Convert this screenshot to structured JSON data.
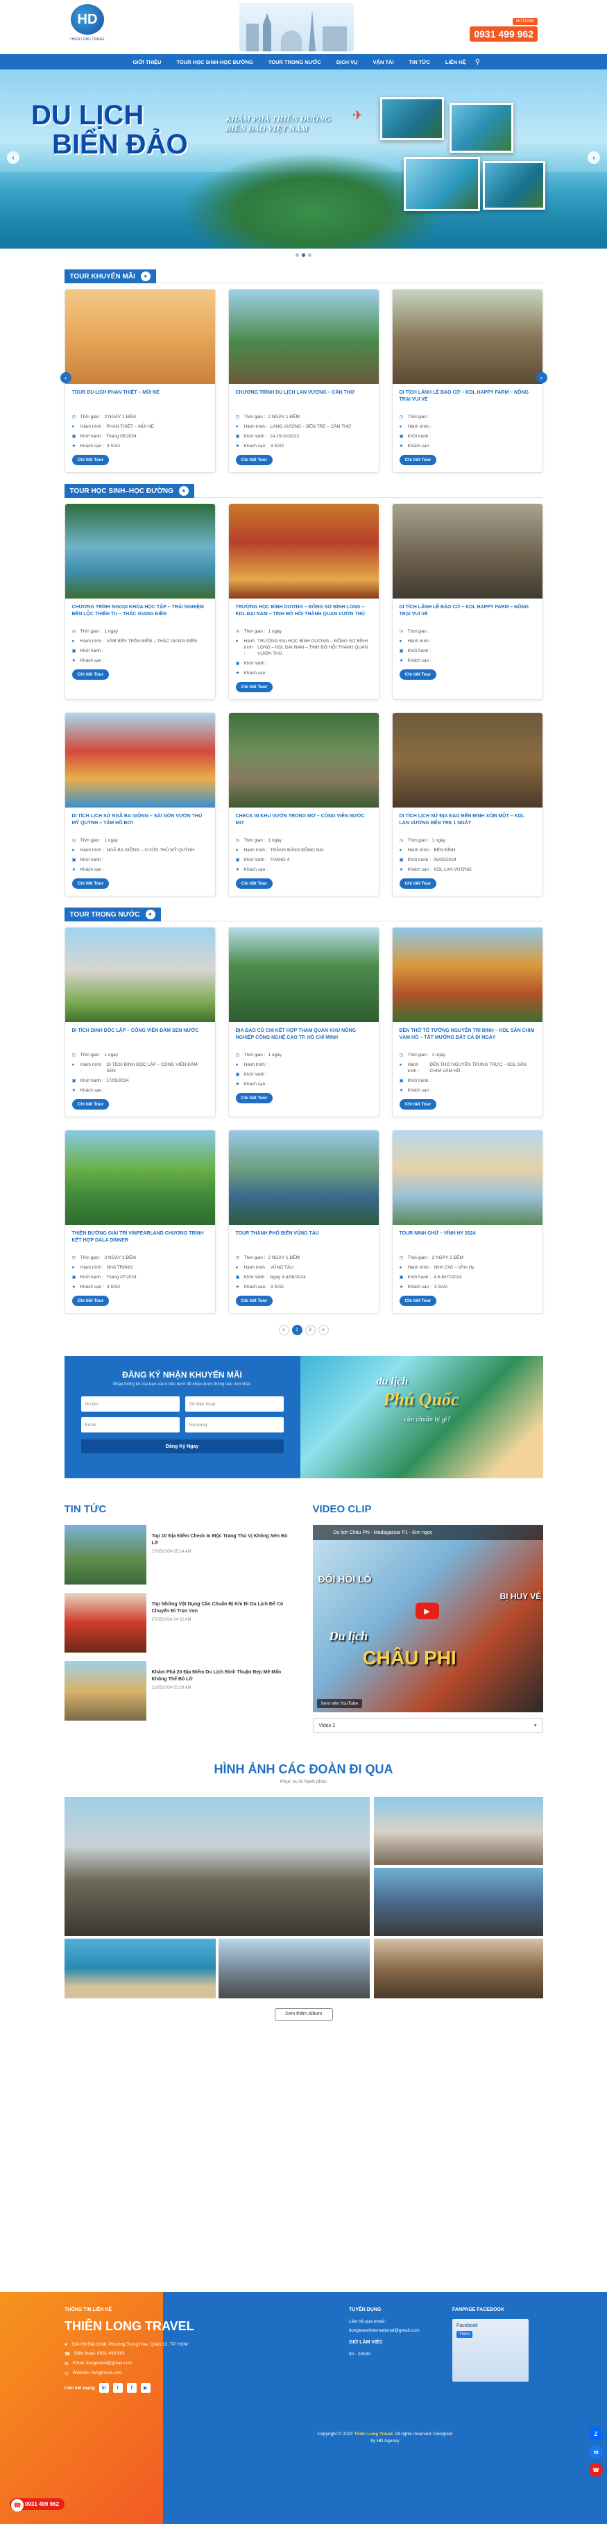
{
  "header": {
    "logo_text": "HD",
    "logo_sub": "THIEN LONG TRAVEL",
    "hotline_label": "HOTLINE",
    "hotline": "0931 499 962"
  },
  "nav": [
    "Giới thiệu",
    "Tour học sinh-học đường",
    "Tour trong nước",
    "Dịch vụ",
    "Vận tải",
    "Tin tức",
    "Liên hệ"
  ],
  "hero": {
    "title1": "DU LỊCH",
    "title2": "BIỂN ĐẢO",
    "subtitle": "KHÁM PHÁ THIÊN ĐƯỜNG BIỂN ĐẢO VIỆT NAM"
  },
  "labels": {
    "time": "Thời gian :",
    "depart": "Hành trình :",
    "start": "Khởi hành :",
    "hotel": "Khách sạn :",
    "detail": "Chi tiết Tour"
  },
  "sections": [
    {
      "title": "Tour khuyến mãi",
      "tours": [
        {
          "name": "Tour du lịch Phan Thiết – Mũi Né",
          "time": "2 NGÀY 1 ĐÊM",
          "route": "PHAN THIẾT – MŨI NÉ",
          "start": "Tháng 05/2024",
          "hotel": "3 SAO",
          "img": "img1"
        },
        {
          "name": "Chương trình du lịch Lan Vương – Cần Thơ",
          "time": "2 NGÀY 1 ĐÊM",
          "route": "LANG VƯƠNG – BẾN TRE – CẦN THƠ",
          "start": "14-15/10/2023",
          "hotel": "3 SAO",
          "img": "img2"
        },
        {
          "name": "Di tích Lãnh Lê Bảo Cờ – KDL Happy Farm – Nông trại vui vẻ",
          "time": "",
          "route": "",
          "start": "",
          "hotel": "",
          "img": "img3"
        }
      ]
    },
    {
      "title": "Tour học sinh–học đường",
      "tours": [
        {
          "name": "Chương trình ngoại khóa học tập – trải nghiệm Bến Lộc Thiền Tu – Thác Giang Điền",
          "time": "1 ngày",
          "route": "VÀM BẾN TRẦN BIÊN – THÁC GIANG ĐIỀN",
          "start": "",
          "hotel": "",
          "img": "img4"
        },
        {
          "name": "Trường học Bình Dương – Đồng Sơ Bình Long – KDL Đại Nam – Tinh Bờ Hồi Thành Quan Vườn Thủ",
          "time": "1 ngày",
          "route": "TRƯỜNG ĐẠI HỌC BÌNH DƯƠNG – ĐỒNG SƠ BÌNH LONG – KDL ĐẠI NAM – TINH BỜ HỒI THÀNH QUAN VƯỜN THỦ",
          "start": "",
          "hotel": "",
          "img": "img5"
        },
        {
          "name": "Di tích Lãnh Lê Bảo Cờ – KDL Happy Farm – Nông trại vui vẻ",
          "time": "",
          "route": "",
          "start": "",
          "hotel": "",
          "img": "img6"
        },
        {
          "name": "Di tích lịch sử Ngã Ba Giồng – Sài Gòn Vườn thú Mỹ Quỳnh – Tâm Hồ Bơi",
          "time": "1 ngày",
          "route": "NGÃ BA GIỒNG – VƯỜN THÚ MỸ QUỲNH",
          "start": "",
          "hotel": "",
          "img": "img7"
        },
        {
          "name": "Check in khu vườn trong mơ – Công viên nước mơ",
          "time": "1 ngày",
          "route": "TRẢNG BÀNG ĐỒNG NAI",
          "start": "THÁNG 4",
          "hotel": "",
          "img": "img8"
        },
        {
          "name": "Di tích lịch sử Địa đạo Bến Đình Xóm Một – KDL Lan Vương Bến Tre 1 ngày",
          "time": "1 ngày",
          "route": "BẾN ĐÌNH",
          "start": "05/05/2024",
          "hotel": "KDL LAN VƯƠNG",
          "img": "img9"
        }
      ]
    },
    {
      "title": "Tour trong nước",
      "tours": [
        {
          "name": "Di tích Dinh Độc Lập – Công viên Đầm Sen nước",
          "time": "1 ngày",
          "route": "DI TÍCH DINH ĐỘC LẬP – CÔNG VIÊN ĐẦM SEN",
          "start": "17/05/2024",
          "hotel": "",
          "img": "img10"
        },
        {
          "name": "Địa đạo Củ Chi kết hợp tham quan khu nông nghiệp công nghệ cao TP. Hồ Chí Minh",
          "time": "1 ngày",
          "route": "",
          "start": "",
          "hotel": "",
          "img": "img11"
        },
        {
          "name": "Đền thờ Tổ Tướng Nguyễn Tri Định – KDL Sân Chim Vàm Hồ – Tất Mường Bắt Cá Đi Ngày",
          "time": "1 ngày",
          "route": "ĐỀN THỜ NGUYỄN TRUNG TRỰC – KDL SÂN CHIM VÀM HỒ",
          "start": "",
          "hotel": "",
          "img": "img12"
        },
        {
          "name": "Thiên đường giải trí VinpearLand Chương trình kết hợp Dala Dinner",
          "time": "3 NGÀY 3 ĐÊM",
          "route": "NHA TRANG",
          "start": "Tháng 07/2024",
          "hotel": "4 SAO",
          "img": "img13"
        },
        {
          "name": "Tour Thành Phố Biển Vũng Tàu",
          "time": "2 NGÀY 1 ĐÊM",
          "route": "VŨNG TÀU",
          "start": "Ngày 3-4/08/2024",
          "hotel": "3 SAO",
          "img": "img14"
        },
        {
          "name": "Tour Ninh Chữ – Vĩnh Hy 2024",
          "time": "3 NGÀY 2 ĐÊM",
          "route": "Ninh Chữ – Vĩnh Hy",
          "start": "4-5-6/07/2024",
          "hotel": "3 SAO",
          "img": "img15"
        }
      ]
    }
  ],
  "pager": [
    "«",
    "1",
    "2",
    "»"
  ],
  "newsletter": {
    "title": "Đăng ký nhận khuyến mãi",
    "sub": "Nhập thông tin của bạn vào ô bên dưới để nhận được thông báo mới nhất.",
    "f1": "Họ tên",
    "f2": "Số điện thoại",
    "f3": "Email",
    "f4": "Nội dung",
    "button": "Đăng Ký Ngay"
  },
  "promo": {
    "t1": "du lịch",
    "t2": "Phú Quốc",
    "t3": "cần chuẩn bị gì?"
  },
  "news": {
    "title": "Tin tức",
    "items": [
      {
        "title": "Top 10 Địa Điểm Check In Mộc Trang Thú Vị Không Nên Bỏ Lỡ",
        "date": "27/05/2024 05:14 AM",
        "img": "n1"
      },
      {
        "title": "Top Những Vật Dụng Cần Chuẩn Bị Khi Đi Du Lịch Để Có Chuyến Đi Trọn Vẹn",
        "date": "27/05/2024 04:32 AM",
        "img": "n2"
      },
      {
        "title": "Khám Phá 20 Địa Điểm Du Lịch Bình Thuận Đẹp Mê Mẩn Không Thể Bỏ Lỡ",
        "date": "21/05/2024 01:20 AM",
        "img": "n3"
      }
    ]
  },
  "video": {
    "title": "Video clip",
    "caption": "Du lịch Châu Phi - Madagascar P1 - Kim ngọc",
    "w1": "Du lịch",
    "w2": "CHÂU PHI",
    "w3": "ĐỔI HỒI LỖ",
    "w4": "BỊ HUY VÉ",
    "foot": "Xem trên YouTube",
    "select": "Video 2"
  },
  "gallery": {
    "title": "Hình ảnh các đoàn đi qua",
    "sub": "Phục vụ là hạnh phúc",
    "more": "Xem thêm Album"
  },
  "footer": {
    "contact_title": "Thông tin liên hệ",
    "brand": "Thiên Long Travel",
    "addr": "13A Hồ Đắc Chất, Phường Trung Hòa, Quận 12, TP. HCM",
    "phone": "Điện thoại: 0931 499 962",
    "email": "Email: tlongtravel@gmail.com",
    "web": "Website: tlongtravel.com",
    "social_label": "Liên kết mạng",
    "hotline_title": "Tuyển dụng",
    "hotline_lines": [
      "Liên hệ qua email:",
      "tlongtravelinternational@gmail.com"
    ],
    "work_title": "Giờ làm việc",
    "work_time": "8h - 20h30",
    "fb_title": "Fanpage Facebook",
    "fb_name": "Facebook",
    "fb_like": "Thích",
    "copyright_pre": "Copyright © 2024",
    "copyright_brand": "Thiên Long Travel",
    "copyright_post": ". All rights reserved. Designed by HD Agency",
    "float_phone": "0931 499 962"
  }
}
